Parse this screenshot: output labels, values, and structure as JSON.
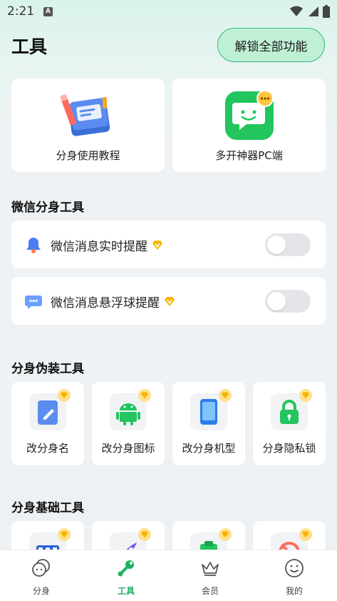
{
  "status": {
    "time": "2:21",
    "notif_letter": "A"
  },
  "header": {
    "title": "工具",
    "unlock_label": "解锁全部功能"
  },
  "top_cards": [
    {
      "label": "分身使用教程",
      "icon": "book-pencil-icon"
    },
    {
      "label": "多开神器PC端",
      "icon": "chat-bubble-icon"
    }
  ],
  "sections": {
    "wechat": "微信分身工具",
    "disguise": "分身伪装工具",
    "basic": "分身基础工具"
  },
  "wechat_tools": [
    {
      "label": "微信消息实时提醒",
      "icon": "bell-icon",
      "enabled": false
    },
    {
      "label": "微信消息悬浮球提醒",
      "icon": "floating-bubble-icon",
      "enabled": false
    }
  ],
  "disguise_tools": [
    {
      "label": "改分身名",
      "icon": "edit-name-icon"
    },
    {
      "label": "改分身图标",
      "icon": "android-icon"
    },
    {
      "label": "改分身机型",
      "icon": "phone-icon"
    },
    {
      "label": "分身隐私锁",
      "icon": "lock-icon"
    }
  ],
  "basic_tools": [
    {
      "icon": "grid-keyboard-icon"
    },
    {
      "icon": "rocket-icon"
    },
    {
      "icon": "clipboard-icon"
    },
    {
      "icon": "no-ads-icon"
    }
  ],
  "nav": [
    {
      "label": "分身",
      "icon": "clone-chat-icon",
      "active": false
    },
    {
      "label": "工具",
      "icon": "wrench-icon",
      "active": true
    },
    {
      "label": "会员",
      "icon": "crown-icon",
      "active": false
    },
    {
      "label": "我的",
      "icon": "smile-icon",
      "active": false
    }
  ],
  "colors": {
    "accent": "#1fae63",
    "vip": "#f5b400",
    "toggle_off": "#e3e5e8"
  }
}
